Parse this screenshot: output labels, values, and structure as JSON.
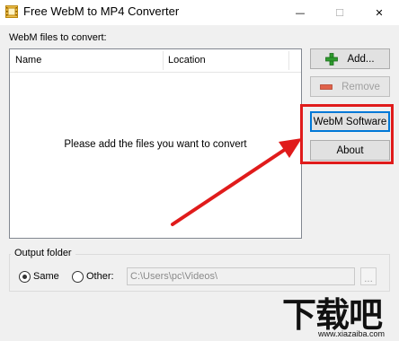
{
  "window": {
    "title": "Free WebM to MP4 Converter",
    "controls": {
      "minimize": "—",
      "maximize": "☐",
      "close": "✕"
    }
  },
  "main": {
    "files_label": "WebM files to convert:",
    "list": {
      "columns": [
        "Name",
        "Location"
      ],
      "empty_message": "Please add the files you want to convert"
    }
  },
  "buttons": {
    "add": "Add...",
    "remove": "Remove",
    "webm_software": "WebM Software",
    "about": "About"
  },
  "output": {
    "group_title": "Output folder",
    "same_label": "Same",
    "other_label": "Other:",
    "selected": "Same",
    "path_value": "C:\\Users\\pc\\Videos\\",
    "browse_label": "..."
  },
  "watermark": {
    "text": "下载吧",
    "url": "www.xiazaiba.com"
  },
  "colors": {
    "highlight": "#e01b1b",
    "arrow": "#e01b1b",
    "add_icon": "#2e9b2e",
    "remove_icon": "#e0624a"
  }
}
